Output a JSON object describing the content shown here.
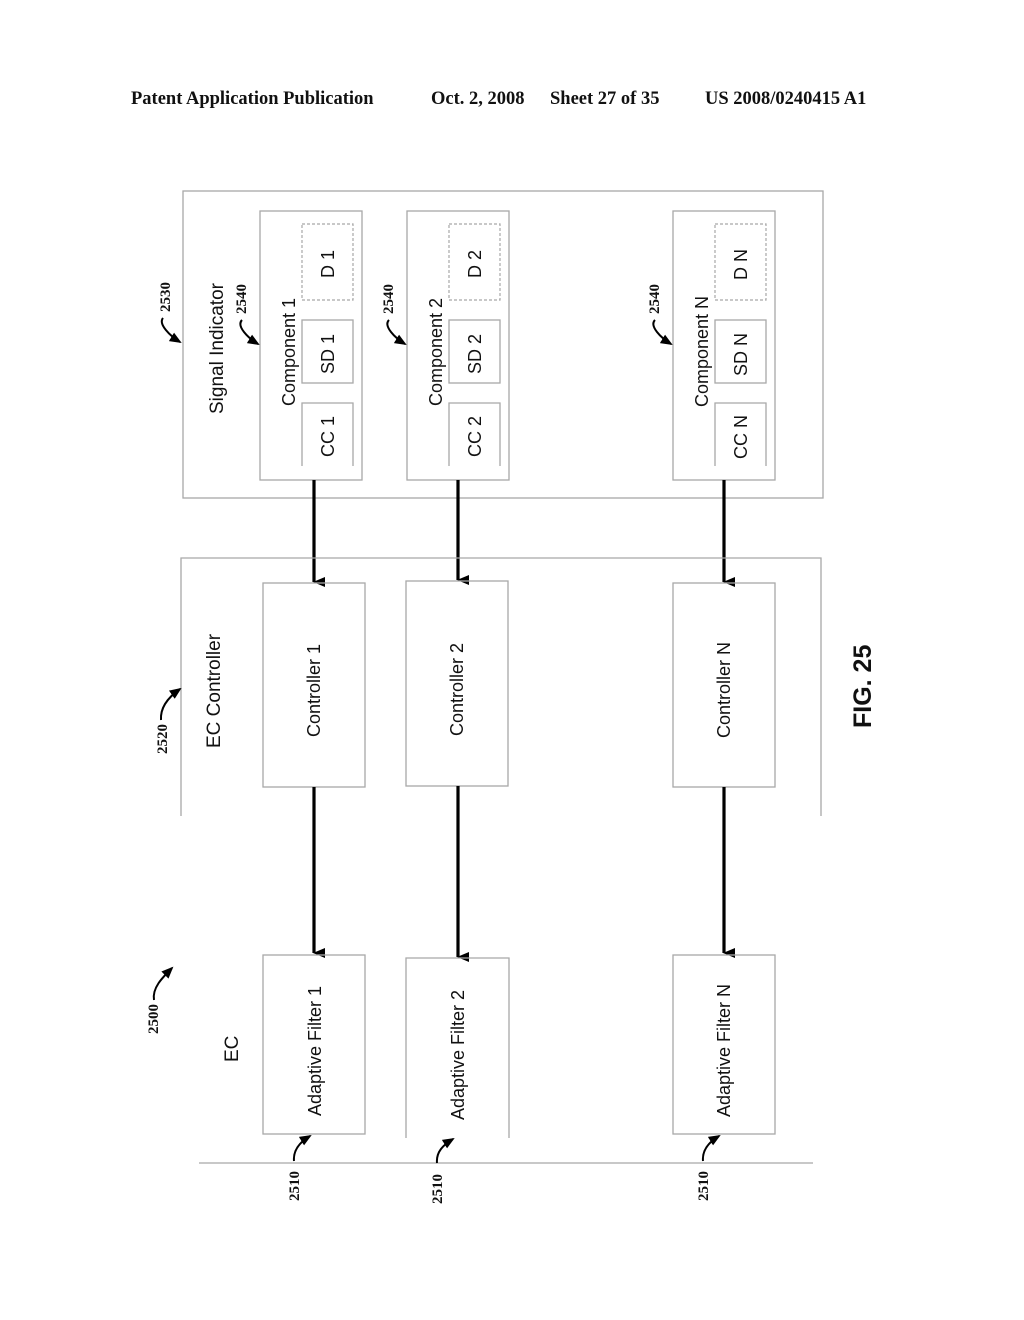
{
  "header": {
    "publication": "Patent Application Publication",
    "date": "Oct. 2, 2008",
    "sheet": "Sheet 27 of 35",
    "number": "US 2008/0240415 A1"
  },
  "figure": {
    "label": "FIG. 25",
    "system_ref": "2500",
    "signal_indicator": {
      "title": "Signal Indicator",
      "ref": "2530",
      "components": [
        {
          "title": "Component 1",
          "ref": "2540",
          "cc": "CC 1",
          "sd": "SD 1",
          "d": "D 1"
        },
        {
          "title": "Component 2",
          "ref": "2540",
          "cc": "CC 2",
          "sd": "SD 2",
          "d": "D 2"
        },
        {
          "title": "Component N",
          "ref": "2540",
          "cc": "CC N",
          "sd": "SD N",
          "d": "D N"
        }
      ]
    },
    "ec_controller": {
      "title": "EC Controller",
      "ref": "2520",
      "controllers": [
        "Controller 1",
        "Controller 2",
        "Controller N"
      ]
    },
    "ec": {
      "title": "EC",
      "filters": [
        {
          "label": "Adaptive Filter 1",
          "ref": "2510"
        },
        {
          "label": "Adaptive Filter 2",
          "ref": "2510"
        },
        {
          "label": "Adaptive Filter N",
          "ref": "2510"
        }
      ]
    }
  }
}
